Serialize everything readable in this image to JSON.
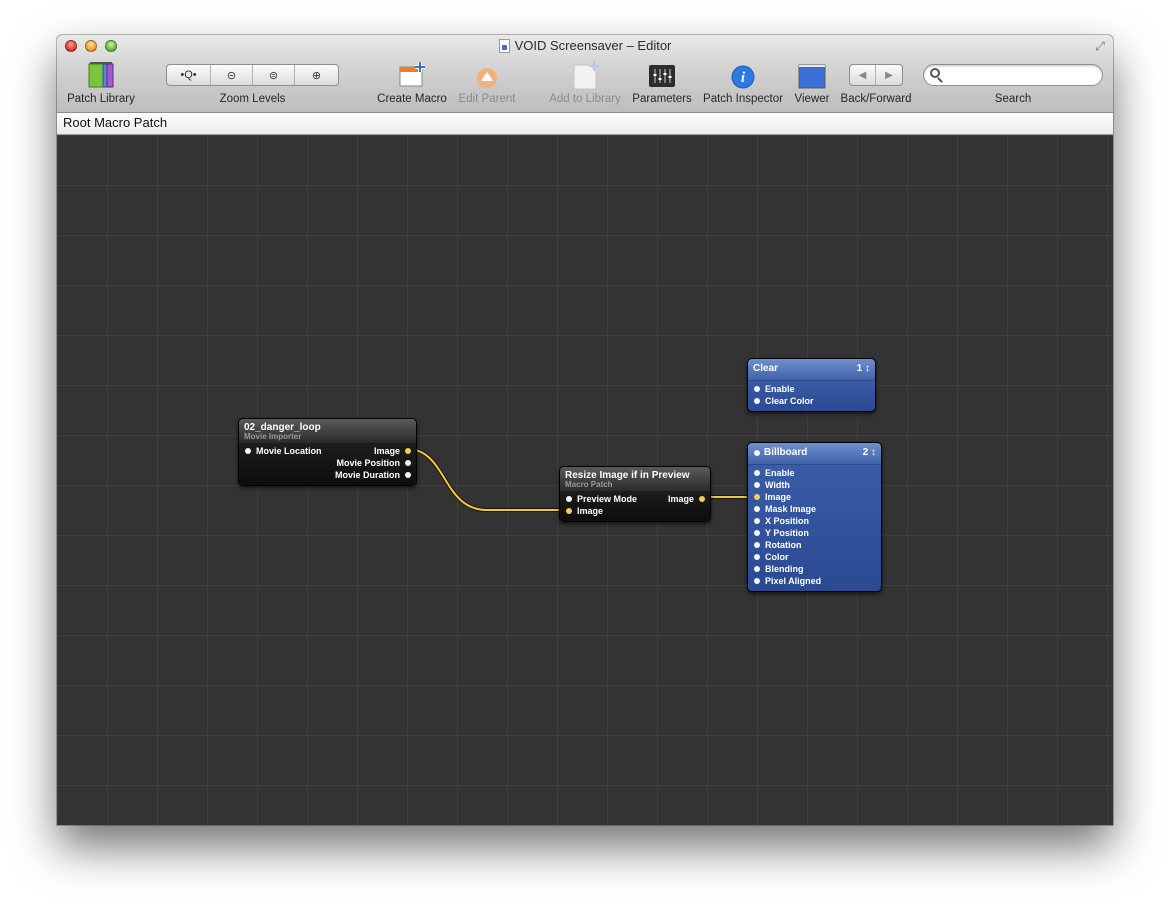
{
  "window": {
    "title": "VOID Screensaver – Editor"
  },
  "toolbar": {
    "patch_library": "Patch Library",
    "zoom_levels": "Zoom Levels",
    "zoom_buttons": [
      "•Q•",
      "⊝",
      "⊜",
      "⊕"
    ],
    "create_macro": "Create Macro",
    "edit_parent": "Edit Parent",
    "add_to_library": "Add to Library",
    "parameters": "Parameters",
    "patch_inspector": "Patch Inspector",
    "viewer": "Viewer",
    "back_forward": "Back/Forward",
    "back_glyph": "◀",
    "forward_glyph": "▶",
    "search": "Search",
    "search_value": "",
    "search_placeholder": ""
  },
  "breadcrumb": "Root Macro Patch",
  "patches": {
    "movie": {
      "name": "02_danger_loop",
      "type": "Movie Importer",
      "inputs": [
        "Movie Location"
      ],
      "outputs": [
        "Image",
        "Movie Position",
        "Movie Duration"
      ]
    },
    "resize": {
      "name": "Resize Image if in Preview",
      "type": "Macro Patch",
      "inputs": [
        "Preview Mode",
        "Image"
      ],
      "outputs": [
        "Image"
      ]
    },
    "clear": {
      "name": "Clear",
      "order": "1 ↕",
      "inputs": [
        "Enable",
        "Clear Color"
      ]
    },
    "billboard": {
      "name": "Billboard",
      "order": "2 ↕",
      "inputs": [
        "Enable",
        "Width",
        "Image",
        "Mask Image",
        "X Position",
        "Y Position",
        "Rotation",
        "Color",
        "Blending",
        "Pixel Aligned"
      ]
    }
  },
  "colors": {
    "cable": "#f2c744",
    "canvas": "#333333",
    "consumer_patch": "#3a5ca6"
  }
}
